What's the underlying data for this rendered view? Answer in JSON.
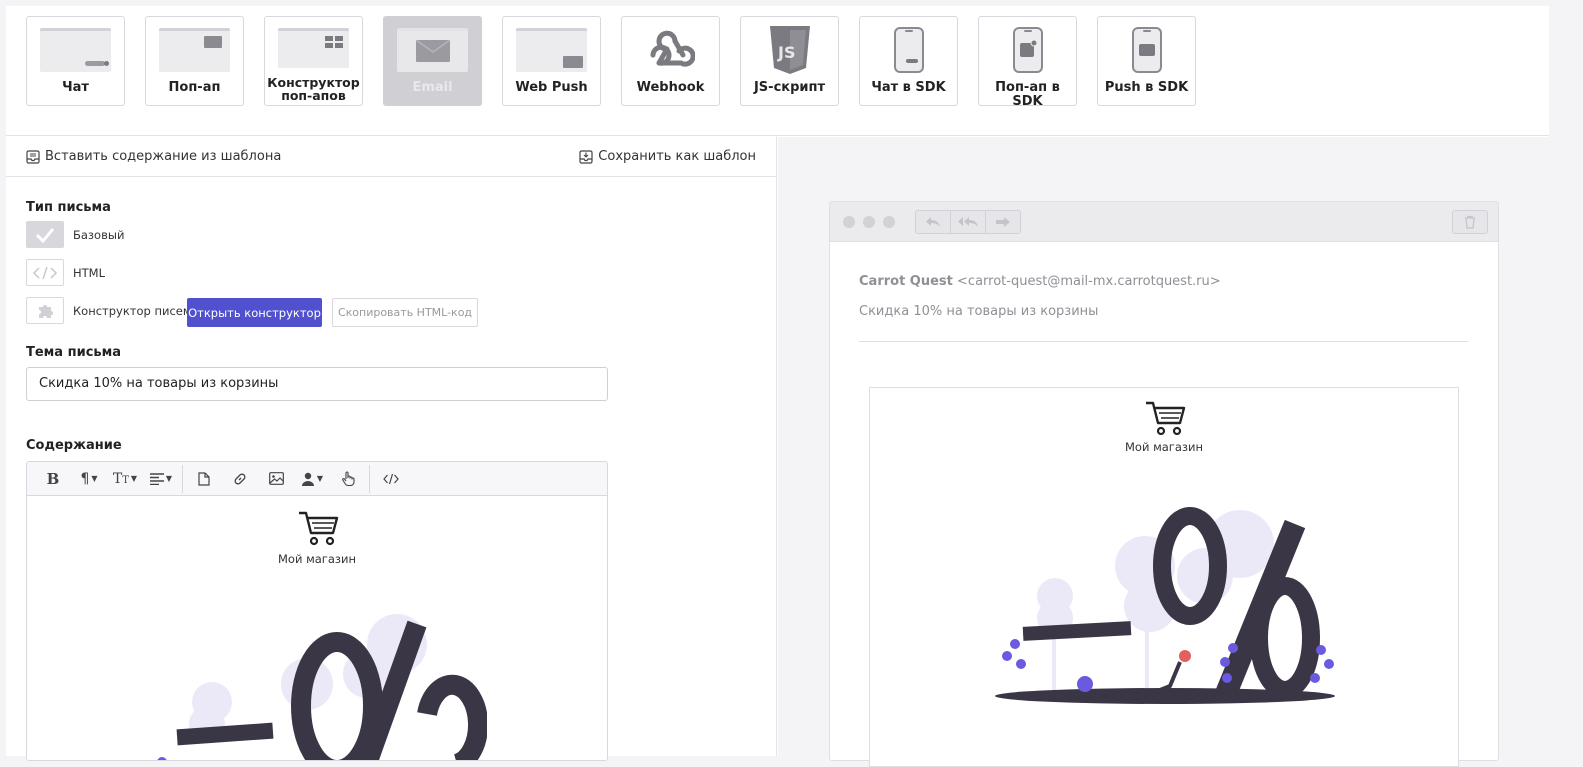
{
  "channels": [
    {
      "label": "Чат",
      "icon": "chat-window-icon"
    },
    {
      "label": "Поп-ап",
      "icon": "popup-window-icon"
    },
    {
      "label": "Конструктор поп-апов",
      "icon": "popup-builder-icon"
    },
    {
      "label": "Email",
      "icon": "email-envelope-icon",
      "active": true
    },
    {
      "label": "Web Push",
      "icon": "web-push-icon"
    },
    {
      "label": "Webhook",
      "icon": "webhook-icon"
    },
    {
      "label": "JS-скрипт",
      "icon": "js-script-icon"
    },
    {
      "label": "Чат в SDK",
      "icon": "sdk-chat-icon"
    },
    {
      "label": "Поп-ап в SDK",
      "icon": "sdk-popup-icon"
    },
    {
      "label": "Push в SDK",
      "icon": "sdk-push-icon"
    }
  ],
  "template_bar": {
    "insert_label": "Вставить содержание из шаблона",
    "save_label": "Сохранить как шаблон"
  },
  "letter_type": {
    "title": "Тип письма",
    "options": [
      {
        "label": "Базовый",
        "selected": true
      },
      {
        "label": "HTML",
        "selected": false
      },
      {
        "label": "Конструктор писем",
        "selected": false
      }
    ],
    "open_builder_label": "Открыть конструктор",
    "copy_html_label": "Скопировать HTML-код"
  },
  "subject": {
    "title": "Тема письма",
    "value": "Скидка 10% на товары из корзины"
  },
  "content": {
    "title": "Содержание",
    "shop_name": "Мой магазин"
  },
  "preview": {
    "sender_name": "Carrot Quest",
    "sender_email": "<carrot-quest@mail-mx.carrotquest.ru>",
    "subject": "Скидка 10% на товары из корзины",
    "shop_name": "Мой магазин"
  },
  "colors": {
    "accent": "#5151d0",
    "illustration_dark": "#3a3646",
    "illustration_light": "#ebe9f7",
    "flower": "#6a5ae0"
  }
}
